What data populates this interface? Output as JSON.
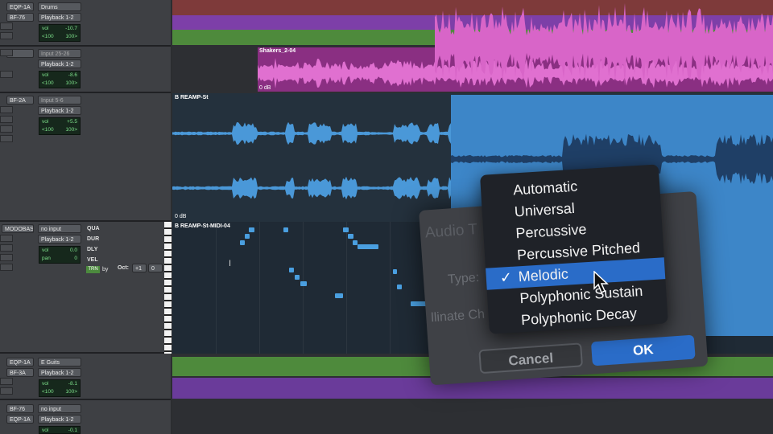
{
  "tracks": [
    {
      "insert_a": "EQP-1A",
      "insert_b": "BF-76",
      "input": "Drums",
      "output": "Playback 1-2",
      "vol_label": "vol",
      "vol": "-10.7",
      "pan_l": "<100",
      "pan_r": "100>"
    },
    {
      "insert_a": "",
      "insert_b": "",
      "input": "Input 25-26",
      "output": "Playback 1-2",
      "vol_label": "vol",
      "vol": "-8.6",
      "pan_l": "<100",
      "pan_r": "100>"
    },
    {
      "insert_a": "BF-2A",
      "insert_b": "",
      "input": "Input 5-6",
      "output": "Playback 1-2",
      "vol_label": "vol",
      "vol": "+5.5",
      "pan_l": "<100",
      "pan_r": "100>"
    },
    {
      "insert_a": "MODOBAS2",
      "insert_b": "",
      "input": "no input",
      "output": "Playback 1-2",
      "vol_label": "vol",
      "vol": "0.0",
      "pan_label": "pan",
      "pan": "0",
      "qua": "QUA",
      "dur": "DUR",
      "dly": "DLY",
      "vel": "VEL",
      "trn": "TRN",
      "by": "by",
      "oct_label": "Oct:",
      "oct": "+1",
      "oct_val": "0"
    },
    {
      "insert_a": "EQP-1A",
      "insert_b": "BF-3A",
      "input": "E Guits",
      "output": "Playback 1-2",
      "vol_label": "vol",
      "vol": "-8.1",
      "pan_l": "<100",
      "pan_r": "100>"
    },
    {
      "insert_a": "BF-76",
      "insert_b": "EQP-1A",
      "input": "no input",
      "output": "Playback 1-2",
      "vol_label": "vol",
      "vol": "-0.1"
    }
  ],
  "clips": {
    "shakers_name": "Shakers_2-04",
    "shakers_gain": "0 dB",
    "reamp_name": "B REAMP-St",
    "reamp_gain": "0 dB",
    "midi_name": "B REAMP-St-MIDI-04"
  },
  "dialog": {
    "title": "Audio T",
    "type_label": "Type:",
    "cut_label": "llinate Ch",
    "cancel": "Cancel",
    "ok": "OK"
  },
  "menu": {
    "items": [
      "Automatic",
      "Universal",
      "Percussive",
      "Percussive Pitched",
      "Melodic",
      "Polyphonic Sustain",
      "Polyphonic Decay"
    ],
    "selected_index": 4,
    "check": "✓"
  },
  "colors": {
    "purple": "#9b4fbf",
    "green": "#4e8a3c",
    "pink": "#c24fb0",
    "blue_wave": "#4a98d8",
    "accent": "#2a6cc8"
  }
}
